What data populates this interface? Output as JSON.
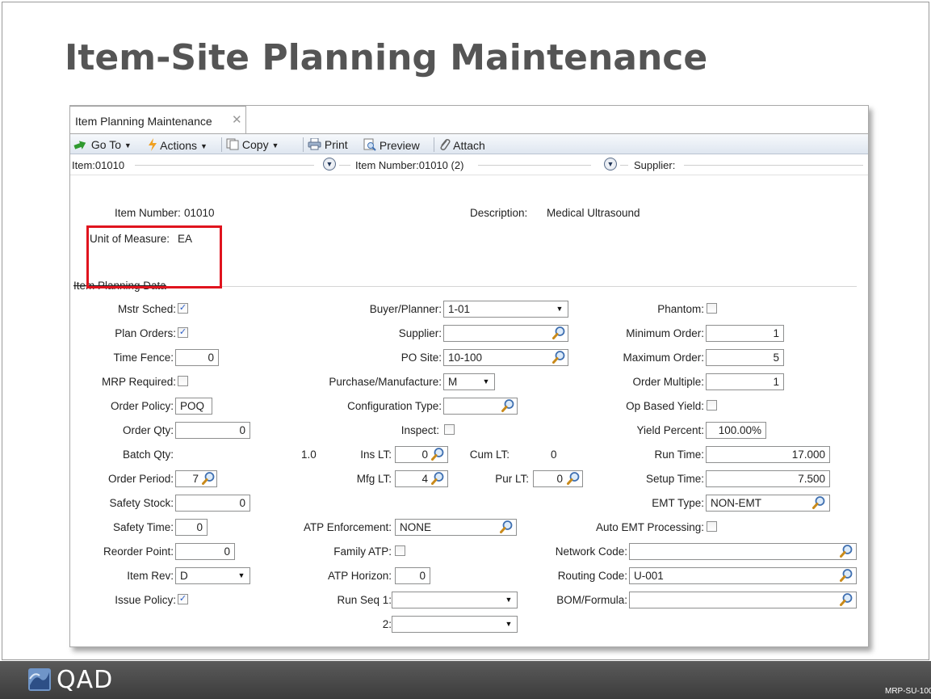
{
  "slide": {
    "title": "Item-Site Planning Maintenance",
    "footer_code": "MRP-SU-100",
    "logo_text": "QAD"
  },
  "tab": {
    "label": "Item Planning Maintenance",
    "close": "✕"
  },
  "toolbar": {
    "goto": "Go To",
    "actions": "Actions",
    "copy": "Copy",
    "print": "Print",
    "preview": "Preview",
    "attach": "Attach"
  },
  "breadcrumb": {
    "item": "Item:01010",
    "item_number": "Item Number:01010 (2)",
    "supplier": "Supplier:"
  },
  "header": {
    "item_number_label": "Item Number:",
    "item_number": "01010",
    "uom_label": "Unit of Measure:",
    "uom": "EA",
    "description_label": "Description:",
    "description": "Medical Ultrasound",
    "section_label": "Item Planning Data"
  },
  "col1": {
    "mstr_sched": {
      "label": "Mstr Sched:",
      "checked": true
    },
    "plan_orders": {
      "label": "Plan Orders:",
      "checked": true
    },
    "time_fence": {
      "label": "Time Fence:",
      "value": "0"
    },
    "mrp_required": {
      "label": "MRP Required:",
      "checked": false
    },
    "order_policy": {
      "label": "Order Policy:",
      "value": "POQ"
    },
    "order_qty": {
      "label": "Order Qty:",
      "value": "0"
    },
    "batch_qty": {
      "label": "Batch Qty:",
      "value": "1.0"
    },
    "order_period": {
      "label": "Order Period:",
      "value": "7"
    },
    "safety_stock": {
      "label": "Safety Stock:",
      "value": "0"
    },
    "safety_time": {
      "label": "Safety Time:",
      "value": "0"
    },
    "reorder_point": {
      "label": "Reorder Point:",
      "value": "0"
    },
    "item_rev": {
      "label": "Item Rev:",
      "value": "D"
    },
    "issue_policy": {
      "label": "Issue Policy:",
      "checked": true
    }
  },
  "col2": {
    "buyer_planner": {
      "label": "Buyer/Planner:",
      "value": "1-01"
    },
    "supplier": {
      "label": "Supplier:",
      "value": ""
    },
    "po_site": {
      "label": "PO Site:",
      "value": "10-100"
    },
    "purch_manuf": {
      "label": "Purchase/Manufacture:",
      "value": "M"
    },
    "config_type": {
      "label": "Configuration Type:",
      "value": ""
    },
    "inspect": {
      "label": "Inspect:",
      "checked": false
    },
    "ins_lt": {
      "label": "Ins LT:",
      "value": "0"
    },
    "cum_lt": {
      "label": "Cum LT:",
      "value": "0"
    },
    "mfg_lt": {
      "label": "Mfg LT:",
      "value": "4"
    },
    "pur_lt": {
      "label": "Pur LT:",
      "value": "0"
    },
    "atp_enforcement": {
      "label": "ATP Enforcement:",
      "value": "NONE"
    },
    "family_atp": {
      "label": "Family ATP:",
      "checked": false
    },
    "atp_horizon": {
      "label": "ATP Horizon:",
      "value": "0"
    },
    "run_seq1": {
      "label": "Run Seq 1:",
      "value": ""
    },
    "run_seq2": {
      "label": "2:",
      "value": ""
    }
  },
  "col3": {
    "phantom": {
      "label": "Phantom:",
      "checked": false
    },
    "min_order": {
      "label": "Minimum Order:",
      "value": "1"
    },
    "max_order": {
      "label": "Maximum Order:",
      "value": "5"
    },
    "order_multiple": {
      "label": "Order Multiple:",
      "value": "1"
    },
    "op_based_yield": {
      "label": "Op Based Yield:",
      "checked": false
    },
    "yield_percent": {
      "label": "Yield Percent:",
      "value": "100.00%"
    },
    "run_time": {
      "label": "Run Time:",
      "value": "17.000"
    },
    "setup_time": {
      "label": "Setup Time:",
      "value": "7.500"
    },
    "emt_type": {
      "label": "EMT Type:",
      "value": "NON-EMT"
    },
    "auto_emt": {
      "label": "Auto EMT Processing:",
      "checked": false
    },
    "network_code": {
      "label": "Network Code:",
      "value": ""
    },
    "routing_code": {
      "label": "Routing Code:",
      "value": "U-001"
    },
    "bom_formula": {
      "label": "BOM/Formula:",
      "value": ""
    }
  },
  "colors": {
    "highlight_box": "#e0141e",
    "checkmark": "#2b5ec7"
  }
}
